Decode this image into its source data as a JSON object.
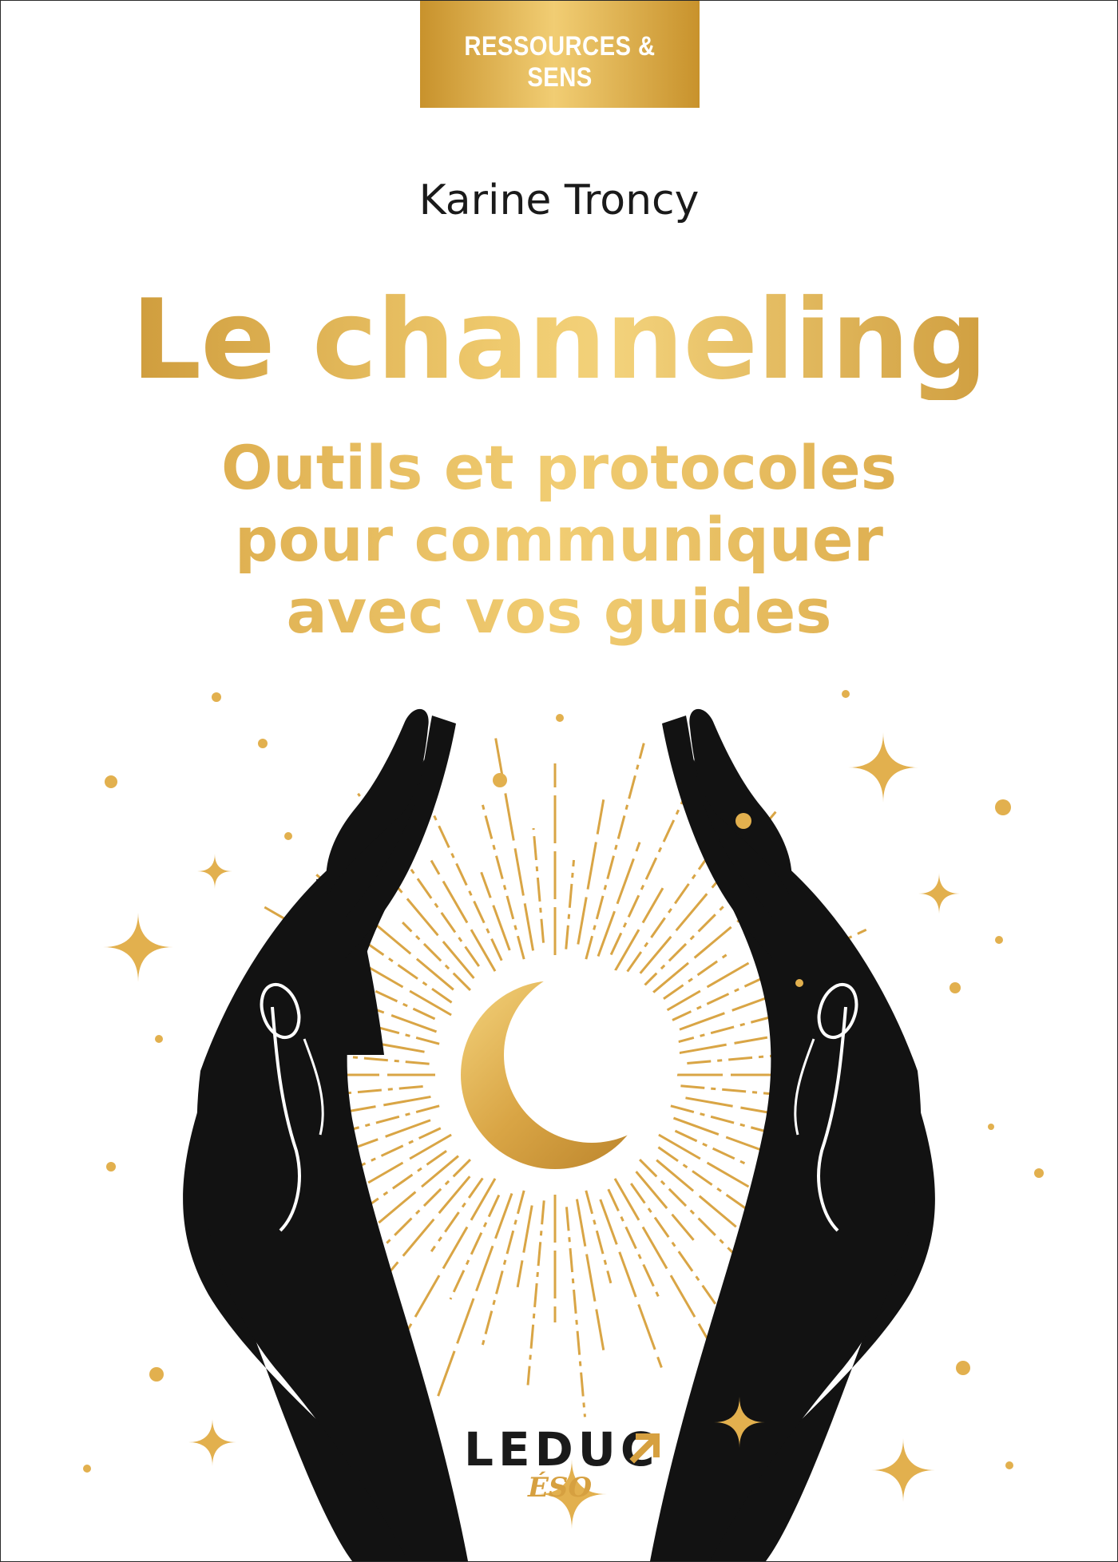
{
  "series": {
    "label": "RESSOURCES & SENS"
  },
  "book": {
    "author": "Karine Troncy",
    "title": "Le channeling",
    "subtitle_lines": [
      "Outils et protocoles",
      "pour communiquer",
      "avec vos guides"
    ]
  },
  "publisher": {
    "name": "LEDUC",
    "imprint": "ÉSO"
  },
  "illustration": {
    "subject": "two-black-hands-holding-golden-crescent-moon",
    "icons": [
      "crescent-moon-icon",
      "sun-rays",
      "sparkle-star-icon",
      "hand-left",
      "hand-right",
      "arrow-icon"
    ]
  },
  "colors": {
    "gold": "#d6a040",
    "gold_light": "#f1cd73",
    "ink": "#1a1a1a",
    "background": "#ffffff"
  }
}
